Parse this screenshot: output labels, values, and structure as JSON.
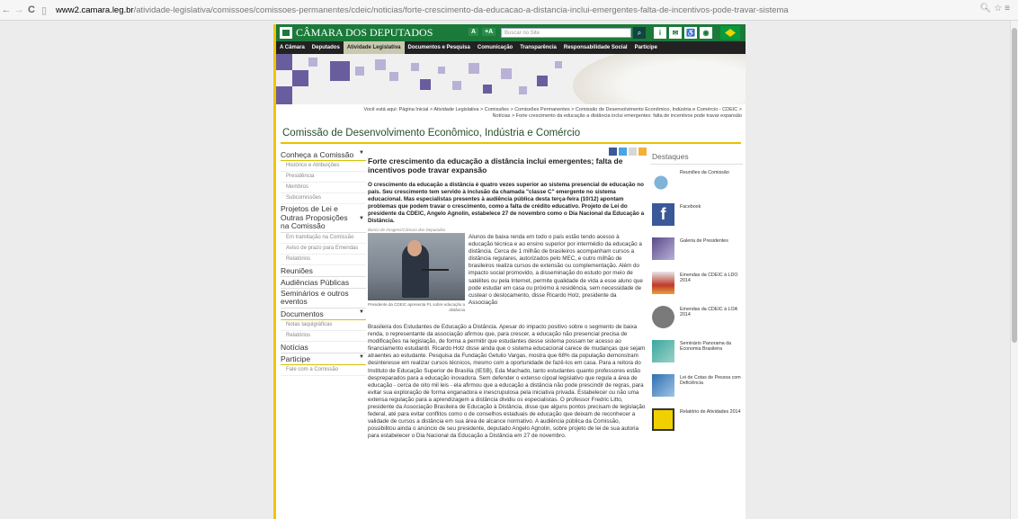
{
  "browser": {
    "back_icon": "back-arrow-icon",
    "forward_icon": "forward-arrow-icon",
    "reload_icon": "reload-icon",
    "url_host": "www2.camara.leg.br",
    "url_path": "/atividade-legislativa/comissoes/comissoes-permanentes/cdeic/noticias/forte-crescimento-da-educacao-a-distancia-inclui-emergentes-falta-de-incentivos-pode-travar-sistema"
  },
  "site": {
    "logo_text": "CÂMARA DOS DEPUTADOS",
    "font_smaller": "A",
    "font_larger": "+A",
    "search_placeholder": "Buscar no Site",
    "menu": [
      "A Câmara",
      "Deputados",
      "Atividade Legislativa",
      "Documentos e Pesquisa",
      "Comunicação",
      "Transparência",
      "Responsabilidade Social",
      "Participe"
    ],
    "menu_active_index": 2
  },
  "breadcrumb": {
    "line1": "Você está aqui: Página Inicial > Atividade Legislativa > Comissões > Comissões Permanentes > Comissão de Desenvolvimento Econômico, Indústria e Comércio - CDEIC >",
    "line2": "Notícias > Forte crescimento da educação a distância inclui emergentes: falta de incentivos pode travar expansão"
  },
  "commission_title": "Comissão de Desenvolvimento Econômico, Indústria e Comércio",
  "leftnav": {
    "conheca": "Conheça a Comissão",
    "conheca_items": [
      "Histórico e Atribuições",
      "Presidência",
      "Membros",
      "Subcomissões"
    ],
    "projetos": "Projetos de Lei e Outras Proposições na Comissão",
    "projetos_items": [
      "Em tramitação na Comissão",
      "Aviso de prazo para Emendas",
      "Relatórios"
    ],
    "reunioes": "Reuniões",
    "audiencias": "Audiências Públicas",
    "seminarios": "Seminários e outros eventos",
    "documentos": "Documentos",
    "documentos_items": [
      "Notas taquigráficas",
      "Relatórios"
    ],
    "noticias": "Notícias",
    "participe": "Participe",
    "participe_items": [
      "Fale com a Comissão"
    ]
  },
  "article": {
    "headline": "Forte crescimento da educação a distância inclui emergentes; falta de incentivos pode travar expansão",
    "lead": "O crescimento da educação a distância é quatro vezes superior ao sistema presencial de educação no país. Seu crescimento tem servido à inclusão da chamada \"classe C\" emergente no sistema educacional. Mas especialistas presentes à audiência pública desta terça-feira (10/12) apontam problemas que podem travar o crescimento, como a falta de crédito educativo. Projeto de Lei do presidente da CDEIC, Angelo Agnolin, estabelece 27 de novembro como o Dia Nacional da Educação a Distância.",
    "photo_credit": "Banco de Imagens/Câmara dos Deputados",
    "photo_caption": "Presidente da CDEIC apresenta PL sobre educação a distância",
    "body_right": "Alunos de baixa renda em todo o país estão tendo acesso à educação técnica e ao ensino superior por intermédio da educação a distância. Cerca de 1 milhão de brasileiros acompanham cursos a distância regulares, autorizados pelo MEC, e outro milhão de brasileiros realiza cursos de extensão ou complementação. Além do impacto social promovido, a disseminação do estudo por meio de satélites ou pela Internet, permite qualidade de vida a esse aluno que pode estudar em casa ou próximo à residência, sem necessidade de custear o deslocamento, disse Ricardo Holz, presidente da Associação",
    "body_full": "Brasileira dos Estudantes de Educação a Distância. Apesar do impacto positivo sobre o segmento de baixa renda, o representante da associação afirmou que, para crescer, a educação não presencial precisa de modificações na legislação, de forma a permitir que estudantes desse sistema possam ter acesso ao financiamento estudantil. Ricardo Holz disse ainda que o sistema educacional carece de mudanças que sejam atraentes ao estudante. Pesquisa da Fundação Getulio Vargas, mostra que 68% da população demonstram desinteresse em realizar cursos técnicos, mesmo com a oportunidade de fazê-los em casa. Para a reitora do Instituto de Educação Superior de Brasília (IESB), Eda Machado, tanto estudantes quanto professores estão despreparados para a educação inovadora. Sem defender o extenso cipoal legislativo que regula a área de educação - cerca de oito mil leis - ela afirmou que a educação a distância não pode prescindir de regras, para evitar sua exploração de forma enganadora e inescrupulosa pela iniciativa privada. Estabelecer ou não uma extensa regulação para a aprendizagem a distância dividiu os especialistas. O professor Fredric Litto, presidente da Associação Brasileira de Educação à Distância, disse que alguns pontos precisam de legislação federal, até para evitar conflitos como o de conselhos estaduais de educação que deixam de reconhecer a validade de cursos a distância em sua área de alcance normativo. A audiência pública da Comissão, possibilitou ainda o anúncio de seu presidente, deputado Angelo Agnolin, sobre projeto de lei de sua autoria para estabelecer o Dia Nacional da Educação a Distância em 27 de novembro."
  },
  "destaques": {
    "title": "Destaques",
    "items": [
      {
        "label": "Reuniões da Comissão",
        "icon": "pen-icon"
      },
      {
        "label": "Facebook",
        "icon": "facebook-icon"
      },
      {
        "label": "Galeria de Presidentes",
        "icon": "gallery-icon"
      },
      {
        "label": "Emendas da CDEIC à LDO 2014",
        "icon": "chart-icon"
      },
      {
        "label": "Emendas da CDEIC à LOA 2014",
        "icon": "building-icon"
      },
      {
        "label": "Seminário Panorama da Economia Brasileira",
        "icon": "seminar-icon"
      },
      {
        "label": "Lei de Cotas de Pessoa com Deficiência",
        "icon": "keyboard-icon"
      },
      {
        "label": "Relatório de Atividades 2014",
        "icon": "report-icon"
      }
    ]
  }
}
